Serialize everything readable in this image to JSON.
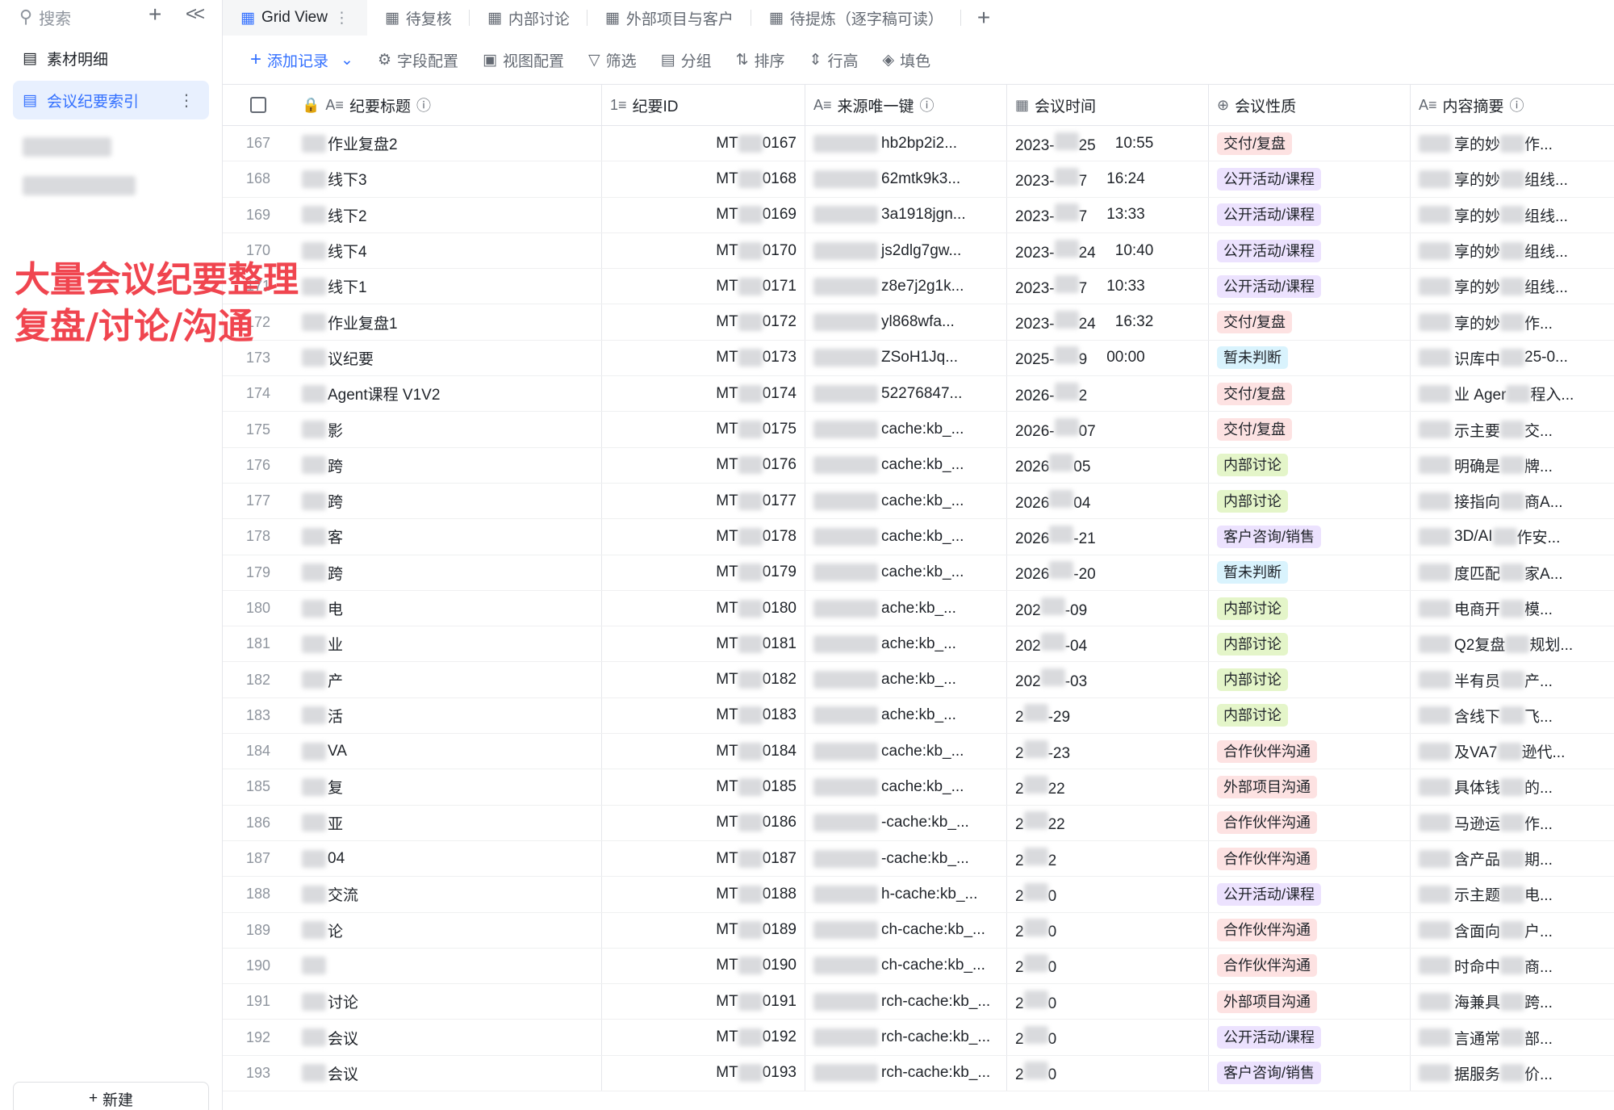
{
  "sidebar": {
    "search_placeholder": "搜索",
    "items": [
      {
        "label": "素材明细"
      },
      {
        "label": "会议纪要索引"
      }
    ],
    "new_label": "新建"
  },
  "overlay": {
    "line1": "大量会议纪要整理",
    "line2": "复盘/讨论/沟通"
  },
  "tabs": [
    {
      "label": "Grid View"
    },
    {
      "label": "待复核"
    },
    {
      "label": "内部讨论"
    },
    {
      "label": "外部项目与客户"
    },
    {
      "label": "待提炼（逐字稿可读）"
    }
  ],
  "toolbar": {
    "add": "添加记录",
    "fields": "字段配置",
    "view": "视图配置",
    "filter": "筛选",
    "group": "分组",
    "sort": "排序",
    "rowh": "行高",
    "fill": "填色"
  },
  "columns": [
    "纪要标题",
    "纪要ID",
    "来源唯一键",
    "会议时间",
    "会议性质",
    "内容摘要"
  ],
  "colors": {
    "accent": "#3370ff",
    "overlay": "#f0454f"
  },
  "rows": [
    {
      "n": "167",
      "title": "作业复盘2",
      "id": "0167",
      "key": "hb2bp2i2...",
      "date": "2023-",
      "date2": "25",
      "time": "10:55",
      "tag": "交付/复盘",
      "tc": "t-red",
      "sum": "享的妙",
      "sum2": "作..."
    },
    {
      "n": "168",
      "title": "线下3",
      "id": "0168",
      "key": "62mtk9k3...",
      "date": "2023-",
      "date2": "7",
      "time": "16:24",
      "tag": "公开活动/课程",
      "tc": "t-pur",
      "sum": "享的妙",
      "sum2": "组线..."
    },
    {
      "n": "169",
      "title": "线下2",
      "id": "0169",
      "key": "3a1918jgn...",
      "date": "2023-",
      "date2": "7",
      "time": "13:33",
      "tag": "公开活动/课程",
      "tc": "t-pur",
      "sum": "享的妙",
      "sum2": "组线..."
    },
    {
      "n": "170",
      "title": "线下4",
      "id": "0170",
      "key": "js2dlg7gw...",
      "date": "2023-",
      "date2": "24",
      "time": "10:40",
      "tag": "公开活动/课程",
      "tc": "t-pur",
      "sum": "享的妙",
      "sum2": "组线..."
    },
    {
      "n": "171",
      "title": "线下1",
      "id": "0171",
      "key": "z8e7j2g1k...",
      "date": "2023-",
      "date2": "7",
      "time": "10:33",
      "tag": "公开活动/课程",
      "tc": "t-pur",
      "sum": "享的妙",
      "sum2": "组线..."
    },
    {
      "n": "172",
      "title": "作业复盘1",
      "id": "0172",
      "key": "yl868wfa...",
      "date": "2023-",
      "date2": "24",
      "time": "16:32",
      "tag": "交付/复盘",
      "tc": "t-red",
      "sum": "享的妙",
      "sum2": "作..."
    },
    {
      "n": "173",
      "title": "议纪要",
      "id": "0173",
      "key": "ZSoH1Jq...",
      "date": "2025-",
      "date2": "9",
      "time": "00:00",
      "tag": "暂未判断",
      "tc": "t-cyan",
      "sum": "识库中",
      "sum2": "25-0..."
    },
    {
      "n": "174",
      "title": "Agent课程 V1V2",
      "id": "0174",
      "key": "52276847...",
      "date": "2026-",
      "date2": "2",
      "time": "",
      "tag": "交付/复盘",
      "tc": "t-red",
      "sum": "业 Ager",
      "sum2": "程入..."
    },
    {
      "n": "175",
      "title": "影",
      "id": "0175",
      "key": "cache:kb_...",
      "date": "2026-",
      "date2": "07",
      "time": "",
      "tag": "交付/复盘",
      "tc": "t-red",
      "sum": "示主要",
      "sum2": "交..."
    },
    {
      "n": "176",
      "title": "跨",
      "id": "0176",
      "key": "cache:kb_...",
      "date": "2026",
      "date2": "05",
      "time": "",
      "tag": "内部讨论",
      "tc": "t-grn",
      "sum": "明确是",
      "sum2": "牌..."
    },
    {
      "n": "177",
      "title": "跨",
      "id": "0177",
      "key": "cache:kb_...",
      "date": "2026",
      "date2": "04",
      "time": "",
      "tag": "内部讨论",
      "tc": "t-grn",
      "sum": "接指向",
      "sum2": "商A..."
    },
    {
      "n": "178",
      "title": "客",
      "id": "0178",
      "key": "cache:kb_...",
      "date": "2026",
      "date2": "-21",
      "time": "",
      "tag": "客户咨询/销售",
      "tc": "t-pur",
      "sum": "3D/AI",
      "sum2": "作安..."
    },
    {
      "n": "179",
      "title": "跨",
      "id": "0179",
      "key": "cache:kb_...",
      "date": "2026",
      "date2": "-20",
      "time": "",
      "tag": "暂未判断",
      "tc": "t-cyan",
      "sum": "度匹配",
      "sum2": "家A..."
    },
    {
      "n": "180",
      "title": "电",
      "id": "0180",
      "key": "ache:kb_...",
      "date": "202",
      "date2": "-09",
      "time": "",
      "tag": "内部讨论",
      "tc": "t-grn",
      "sum": "电商开",
      "sum2": "模..."
    },
    {
      "n": "181",
      "title": "业",
      "id": "0181",
      "key": "ache:kb_...",
      "date": "202",
      "date2": "-04",
      "time": "",
      "tag": "内部讨论",
      "tc": "t-grn",
      "sum": "Q2复盘",
      "sum2": "规划..."
    },
    {
      "n": "182",
      "title": "产",
      "id": "0182",
      "key": "ache:kb_...",
      "date": "202",
      "date2": "-03",
      "time": "",
      "tag": "内部讨论",
      "tc": "t-grn",
      "sum": "半有员",
      "sum2": "产..."
    },
    {
      "n": "183",
      "title": "活",
      "id": "0183",
      "key": "ache:kb_...",
      "date": "2",
      "date2": "-29",
      "time": "",
      "tag": "内部讨论",
      "tc": "t-grn",
      "sum": "含线下",
      "sum2": "飞..."
    },
    {
      "n": "184",
      "title": "VA",
      "id": "0184",
      "key": "cache:kb_...",
      "date": "2",
      "date2": "-23",
      "time": "",
      "tag": "合作伙伴沟通",
      "tc": "t-red",
      "sum": "及VA7",
      "sum2": "逊代..."
    },
    {
      "n": "185",
      "title": "复",
      "id": "0185",
      "key": "cache:kb_...",
      "date": "2",
      "date2": "22",
      "time": "",
      "tag": "外部项目沟通",
      "tc": "t-red",
      "sum": "具体钱",
      "sum2": "的..."
    },
    {
      "n": "186",
      "title": "亚",
      "id": "0186",
      "key": "-cache:kb_...",
      "date": "2",
      "date2": "22",
      "time": "",
      "tag": "合作伙伴沟通",
      "tc": "t-red",
      "sum": "马逊运",
      "sum2": "作..."
    },
    {
      "n": "187",
      "title": "04",
      "id": "0187",
      "key": "-cache:kb_...",
      "date": "2",
      "date2": "2",
      "time": "",
      "tag": "合作伙伴沟通",
      "tc": "t-red",
      "sum": "含产品",
      "sum2": "期..."
    },
    {
      "n": "188",
      "title": "交流",
      "id": "0188",
      "key": "h-cache:kb_...",
      "date": "2",
      "date2": "0",
      "time": "",
      "tag": "公开活动/课程",
      "tc": "t-pur",
      "sum": "示主题",
      "sum2": "电..."
    },
    {
      "n": "189",
      "title": "论",
      "id": "0189",
      "key": "ch-cache:kb_...",
      "date": "2",
      "date2": "0",
      "time": "",
      "tag": "合作伙伴沟通",
      "tc": "t-red",
      "sum": "含面向",
      "sum2": "户..."
    },
    {
      "n": "190",
      "title": "",
      "id": "0190",
      "key": "ch-cache:kb_...",
      "date": "2",
      "date2": "0",
      "time": "",
      "tag": "合作伙伴沟通",
      "tc": "t-red",
      "sum": "时命中",
      "sum2": "商..."
    },
    {
      "n": "191",
      "title": "讨论",
      "id": "0191",
      "key": "rch-cache:kb_...",
      "date": "2",
      "date2": "0",
      "time": "",
      "tag": "外部项目沟通",
      "tc": "t-red",
      "sum": "海兼具",
      "sum2": "跨..."
    },
    {
      "n": "192",
      "title": "会议",
      "id": "0192",
      "key": "rch-cache:kb_...",
      "date": "2",
      "date2": "0",
      "time": "",
      "tag": "公开活动/课程",
      "tc": "t-pur",
      "sum": "言通常",
      "sum2": "部..."
    },
    {
      "n": "193",
      "title": "会议",
      "id": "0193",
      "key": "rch-cache:kb_...",
      "date": "2",
      "date2": "0",
      "time": "",
      "tag": "客户咨询/销售",
      "tc": "t-pur",
      "sum": "据服务",
      "sum2": "价..."
    }
  ]
}
